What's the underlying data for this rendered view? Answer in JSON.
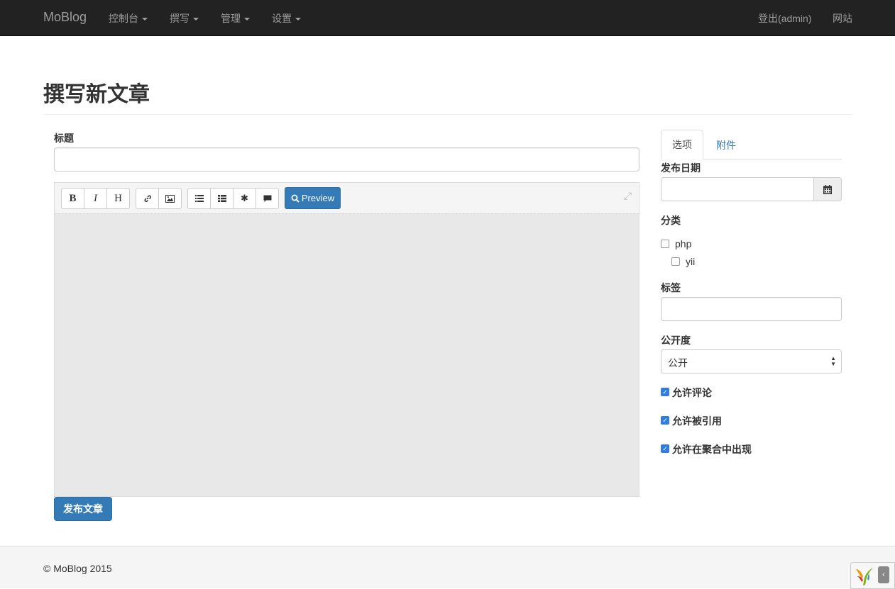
{
  "navbar": {
    "brand": "MoBlog",
    "menus": [
      {
        "label": "控制台"
      },
      {
        "label": "撰写"
      },
      {
        "label": "管理"
      },
      {
        "label": "设置"
      }
    ],
    "right": {
      "logout": "登出(admin)",
      "site": "网站"
    }
  },
  "page": {
    "title": "撰写新文章"
  },
  "form": {
    "title_label": "标题",
    "title_value": "",
    "editor": {
      "toolbar": {
        "bold": "B",
        "italic": "I",
        "heading": "H",
        "link_icon": "link-icon",
        "image_icon": "image-icon",
        "ul_icon": "unordered-list-icon",
        "ol_icon": "ordered-list-icon",
        "code_icon": "asterisk-icon",
        "quote_icon": "comment-icon",
        "preview": "Preview",
        "fullscreen_icon": "fullscreen-icon"
      },
      "content": ""
    },
    "submit": "发布文章"
  },
  "sidebar": {
    "tabs": [
      {
        "label": "选项",
        "active": true
      },
      {
        "label": "附件",
        "active": false
      }
    ],
    "publish_date_label": "发布日期",
    "publish_date_value": "",
    "category_label": "分类",
    "categories": [
      {
        "name": "php",
        "checked": false
      },
      {
        "name": "yii",
        "checked": false
      }
    ],
    "tags_label": "标签",
    "tags_value": "",
    "visibility_label": "公开度",
    "visibility_value": "公开",
    "options": [
      {
        "label": "允许评论",
        "checked": true
      },
      {
        "label": "允许被引用",
        "checked": true
      },
      {
        "label": "允许在聚合中出现",
        "checked": true
      }
    ]
  },
  "footer": {
    "copyright": "© MoBlog 2015"
  },
  "colors": {
    "primary": "#337ab7",
    "navbar": "#222222",
    "checkbox": "#2f7de1"
  }
}
